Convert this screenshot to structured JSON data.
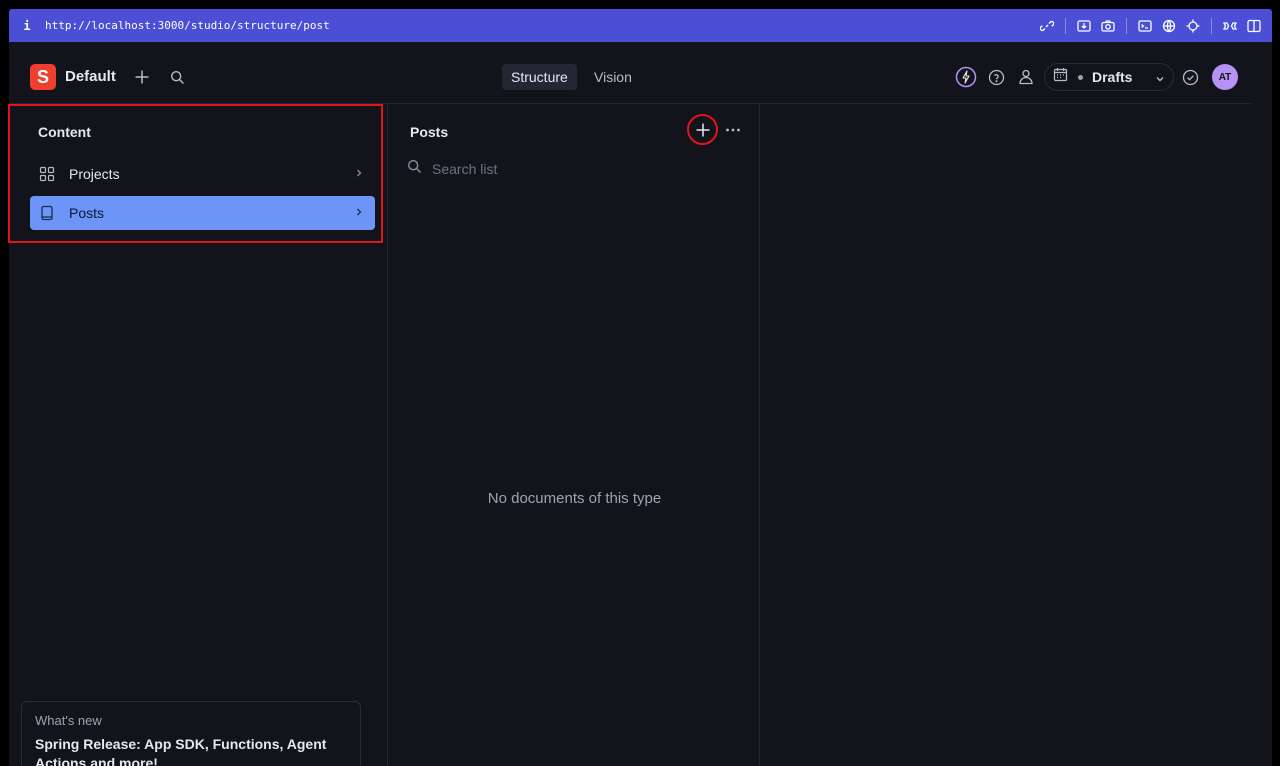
{
  "browser": {
    "info_glyph": "i",
    "url": "http://localhost:3000/studio/structure/post"
  },
  "nav": {
    "logo_letter": "S",
    "workspace": "Default",
    "tools": [
      "Structure",
      "Vision"
    ],
    "active_tool": "Structure",
    "perspective": "Drafts",
    "avatar_initials": "AT",
    "accent_color": "#f03e2f",
    "avatar_color": "#b592f3"
  },
  "content_pane": {
    "title": "Content",
    "items": [
      {
        "label": "Projects",
        "icon": "grid-icon",
        "selected": false
      },
      {
        "label": "Posts",
        "icon": "document-icon",
        "selected": true
      }
    ],
    "selected_color": "#6c95f7"
  },
  "posts_pane": {
    "title": "Posts",
    "search_placeholder": "Search list",
    "empty_message": "No documents of this type"
  },
  "whats_new": {
    "kicker": "What's new",
    "title": "Spring Release: App SDK, Functions, Agent Actions and more!"
  }
}
